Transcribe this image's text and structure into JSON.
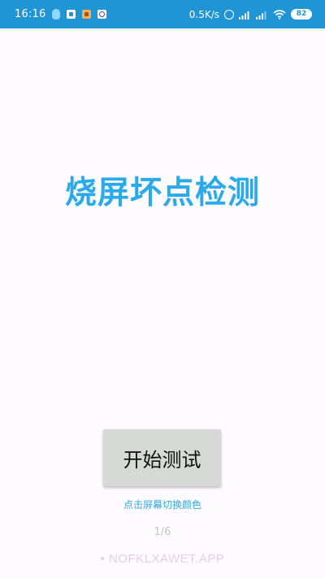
{
  "status_bar": {
    "time": "16:16",
    "notification_icons": [
      "qq-icon",
      "square-app-icon",
      "orange-app-icon",
      "circle-app-icon"
    ],
    "network_speed": "0.5K/s",
    "system_icons": [
      "alarm-icon",
      "signal-hd-icon",
      "signal-icon",
      "wifi-icon"
    ],
    "battery": "82",
    "background_color": "#1f95d6"
  },
  "main": {
    "title": "烧屏坏点检测",
    "start_button_label": "开始测试",
    "hint": "点击屏幕切换颜色",
    "page_indicator": "1/6",
    "watermark": "• NOFKLXAWET.APP"
  },
  "colors": {
    "accent": "#2aaaea",
    "button_bg": "#d6d9d5",
    "page_bg": "#fdfbfe"
  }
}
